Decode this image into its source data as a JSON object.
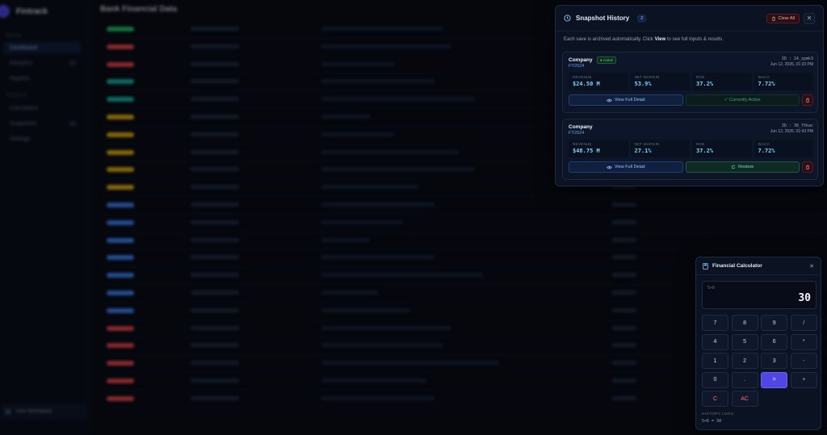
{
  "background": {
    "app_name": "Fintrack",
    "page_title": "Bank Financial Data",
    "nav_sections": [
      "MAIN",
      "TOOLS"
    ],
    "nav_items": [
      "Dashboard",
      "Analytics",
      "Reports",
      "Calculators",
      "Snapshots",
      "Settings"
    ],
    "user_name": "User Workspace"
  },
  "snapshot_panel": {
    "title": "Snapshot History",
    "count": "2",
    "clear_label": "Clear All",
    "description_before": "Each save is archived automatically. Click ",
    "description_bold": "View",
    "description_after": " to see full inputs & results.",
    "snapshots": [
      {
        "company": "Company",
        "fiscal_year": "FY2024",
        "active_badge": "● Active",
        "id": "ID : 14_zpmk3",
        "date": "Jun 12, 2026, 01:33 PM",
        "metrics": [
          {
            "label": "REVENUE",
            "value": "$24.50 M"
          },
          {
            "label": "NET MARGIN",
            "value": "53.9%"
          },
          {
            "label": "ROE",
            "value": "37.2%"
          },
          {
            "label": "WACC",
            "value": "7.72%"
          }
        ],
        "view_label": "View Full Detail",
        "secondary_label": "✓ Currently Active"
      },
      {
        "company": "Company",
        "fiscal_year": "FY2024",
        "id": "ID : 38_f5kac",
        "date": "Jun 12, 2026, 01:43 PM",
        "metrics": [
          {
            "label": "REVENUE",
            "value": "$48.75 M"
          },
          {
            "label": "NET MARGIN",
            "value": "27.1%"
          },
          {
            "label": "ROE",
            "value": "37.2%"
          },
          {
            "label": "WACC",
            "value": "7.72%"
          }
        ],
        "view_label": "View Full Detail",
        "secondary_label": "Restore"
      }
    ]
  },
  "calculator": {
    "title": "Financial Calculator",
    "expression": "5×6",
    "display": "30",
    "keys": [
      "7",
      "8",
      "9",
      "/",
      "4",
      "5",
      "6",
      "*",
      "1",
      "2",
      "3",
      "-",
      "0",
      ".",
      "=",
      "+",
      "C",
      "AC"
    ],
    "history_label": "HISTORY LOGS",
    "history": [
      "5×6 = 30"
    ]
  },
  "colors": {
    "accent": "#4f46e5",
    "positive": "#4ade80",
    "danger": "#f87171",
    "value": "#7dd3fc"
  }
}
